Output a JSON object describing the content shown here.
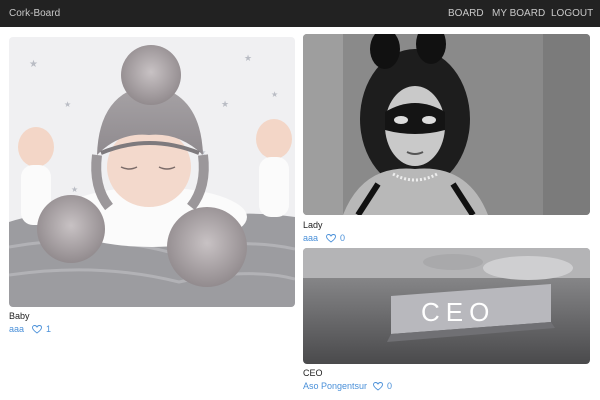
{
  "navbar": {
    "brand": "Cork-Board",
    "links": [
      "BOARD",
      "MY BOARD",
      "LOGOUT"
    ]
  },
  "cards": [
    {
      "title": "Baby",
      "author": "aaa",
      "likes": "1",
      "image": "baby-in-knit-hat-photo"
    },
    {
      "title": "Lady",
      "author": "aaa",
      "likes": "0",
      "image": "woman-bunny-ears-mask-photo"
    },
    {
      "title": "CEO",
      "author": "Aso Pongentsur",
      "likes": "0",
      "image": "ceo-desk-nameplate-photo"
    }
  ],
  "colors": {
    "navbar_bg": "#222222",
    "nav_text": "#c8c8c8",
    "link": "#4a90d9"
  },
  "icons": {
    "like": "heart-outline-icon"
  }
}
